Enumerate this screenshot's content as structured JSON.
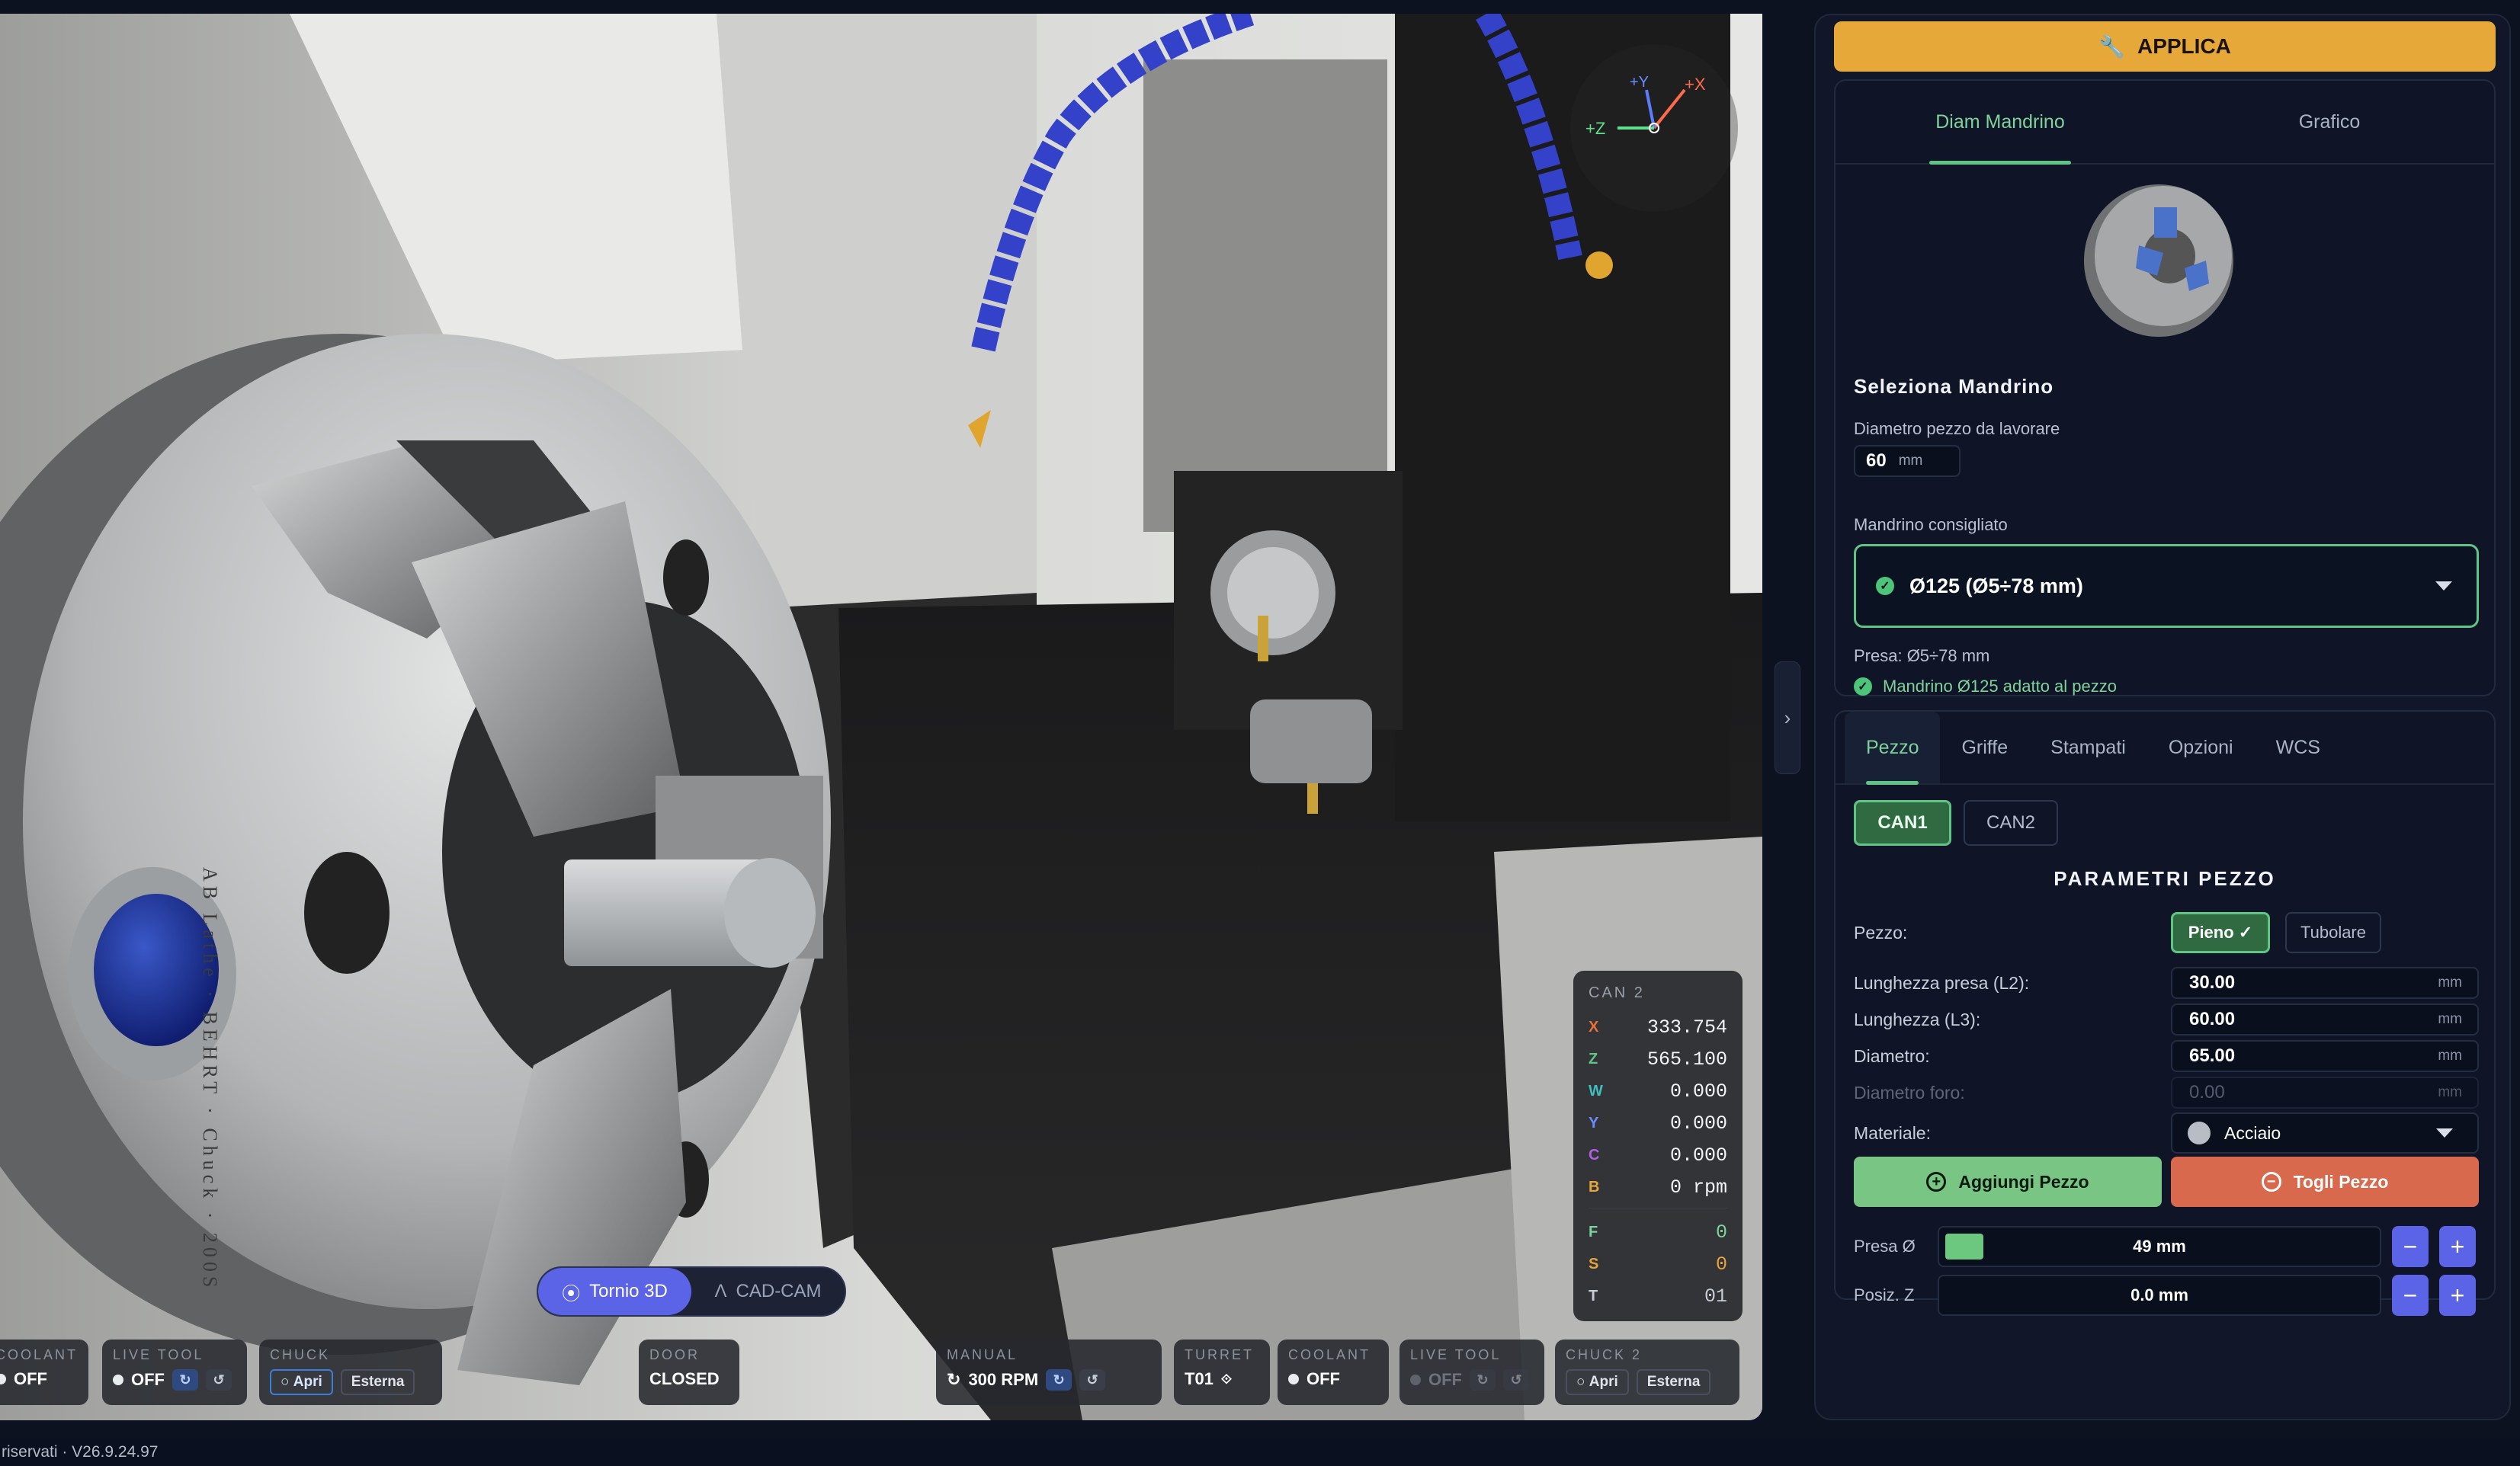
{
  "viewport": {
    "axis_gizmo": {
      "plus_y": "+Y",
      "plus_x": "+X",
      "plus_z": "+Z"
    },
    "chuck_engraving": "AB Lathe · BEHRT · Chuck · 200S",
    "dro": {
      "title": "CAN 2",
      "axes": [
        {
          "axis": "X",
          "value": "333.754",
          "color": "#e8703a"
        },
        {
          "axis": "Z",
          "value": "565.100",
          "color": "#5fc585"
        },
        {
          "axis": "W",
          "value": "0.000",
          "color": "#3fbfbf"
        },
        {
          "axis": "Y",
          "value": "0.000",
          "color": "#6a8cff"
        },
        {
          "axis": "C",
          "value": "0.000",
          "color": "#b15fe6"
        },
        {
          "axis": "B",
          "value": "0 rpm",
          "color": "#e6a43a"
        }
      ],
      "feeds": [
        {
          "axis": "F",
          "value": "0",
          "color": "#7fd29a"
        },
        {
          "axis": "S",
          "value": "0",
          "color": "#e6a43a"
        },
        {
          "axis": "T",
          "value": "01",
          "color": "#c7ccd6"
        }
      ]
    },
    "mode_toggle": {
      "active": "Tornio 3D",
      "inactive": "CAD-CAM"
    }
  },
  "status_bar": {
    "coolant1": {
      "label": "COOLANT",
      "value": "OFF"
    },
    "live_tool1": {
      "label": "LIVE TOOL",
      "value": "OFF"
    },
    "chuck1": {
      "label": "CHUCK",
      "open": "Apri",
      "mode": "Esterna"
    },
    "door": {
      "label": "DOOR",
      "value": "CLOSED"
    },
    "manual": {
      "label": "MANUAL",
      "value": "300 RPM"
    },
    "turret": {
      "label": "TURRET",
      "value": "T01"
    },
    "coolant2": {
      "label": "COOLANT",
      "value": "OFF"
    },
    "live_tool2": {
      "label": "LIVE TOOL",
      "value": "OFF"
    },
    "chuck2": {
      "label": "CHUCK 2",
      "open": "Apri",
      "mode": "Esterna"
    }
  },
  "footer": {
    "text": "riservati  ·  V26.9.24.97"
  },
  "side": {
    "apply_label": "APPLICA",
    "chuck_tabs": [
      "Diam Mandrino",
      "Grafico"
    ],
    "section_title": "Seleziona Mandrino",
    "diam_label": "Diametro pezzo da lavorare",
    "diam_value": "60",
    "diam_unit": "mm",
    "recommended_label": "Mandrino consigliato",
    "recommended_value": "Ø125  (Ø5÷78 mm)",
    "presa_text": "Presa: Ø5÷78 mm",
    "fit_message": "Mandrino Ø125 adatto al pezzo",
    "params_tabs": [
      "Pezzo",
      "Griffe",
      "Stampati",
      "Opzioni",
      "WCS"
    ],
    "can_buttons": [
      "CAN1",
      "CAN2"
    ],
    "params_title": "PARAMETRI PEZZO",
    "pezzo_label": "Pezzo:",
    "pezzo_options": [
      "Pieno ✓",
      "Tubolare"
    ],
    "rows": [
      {
        "label": "Lunghezza presa (L2):",
        "value": "30.00",
        "unit": "mm"
      },
      {
        "label": "Lunghezza (L3):",
        "value": "60.00",
        "unit": "mm"
      },
      {
        "label": "Diametro:",
        "value": "65.00",
        "unit": "mm"
      },
      {
        "label": "Diametro foro:",
        "value": "0.00",
        "unit": "mm"
      }
    ],
    "material_label": "Materiale:",
    "material_value": "Acciaio",
    "add_label": "Aggiungi Pezzo",
    "remove_label": "Togli Pezzo",
    "presa_diam": {
      "label": "Presa Ø",
      "value": "49 mm"
    },
    "posiz_z": {
      "label": "Posiz. Z",
      "value": "0.0 mm"
    },
    "accent": "#5fc585",
    "apply_color": "#e7a83a"
  }
}
